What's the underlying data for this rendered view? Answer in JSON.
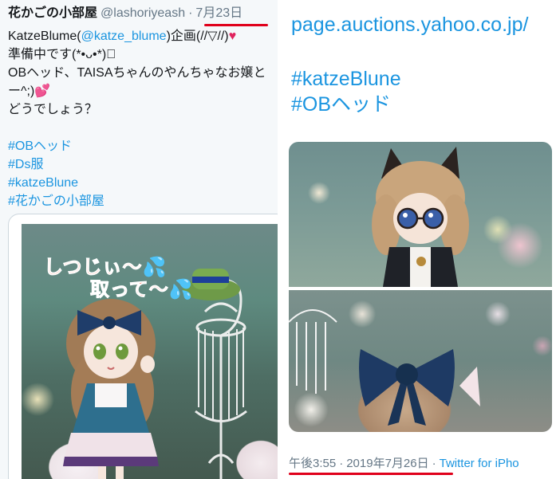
{
  "left_tweet": {
    "display_name": "花かごの小部屋",
    "handle": "@lashoriyeash",
    "separator": "·",
    "date": "7月23日",
    "text_lines": {
      "l1_pre": "KatzeBlume(",
      "l1_mention": "@katze_blume",
      "l1_post": ")企画(//▽//)",
      "l1_heart": "♥",
      "l2": "準備中です(*•ᴗ•*)ﾞ",
      "l3": "OBヘッド、TAISAちゃんのやんちゃなお嬢と",
      "l4_pre": "ー^;)",
      "l4_heart": "💕",
      "l5": "どうでしょう？"
    },
    "hashtags": [
      "#OBヘッド",
      "#Ds服",
      "#katzeBlune",
      "#花かごの小部屋"
    ],
    "photo_captions": {
      "line1": "しつじぃ〜💦",
      "line2": "取って〜💦"
    }
  },
  "right_tweet": {
    "link": "page.auctions.yahoo.co.jp/",
    "hashtags": [
      "#katzeBlune",
      "#OBヘッド"
    ],
    "time": "午後3:55",
    "sep": "·",
    "date": "2019年7月26日",
    "sep2": "·",
    "source": "Twitter for iPho"
  },
  "colors": {
    "link": "#1b95e0",
    "underline": "#e0001b",
    "text": "#14171a",
    "muted": "#657786"
  }
}
